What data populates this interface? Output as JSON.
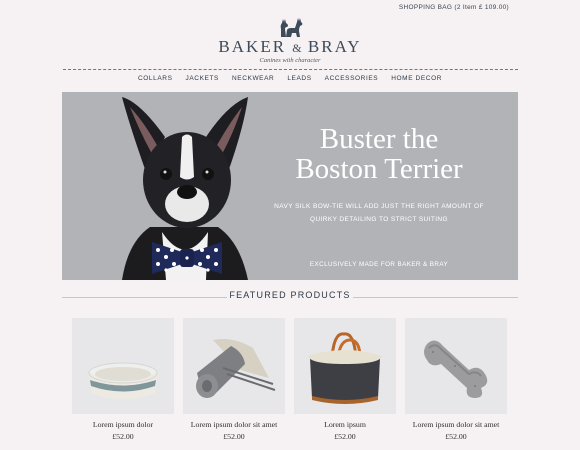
{
  "header": {
    "shopping_bag": "SHOPPING BAG (2 Item £ 109.00)",
    "brand_left": "BAKER",
    "brand_amp": "&",
    "brand_right": "BRAY",
    "tagline": "Canines with character"
  },
  "nav": {
    "items": [
      "COLLARS",
      "JACKETS",
      "NECKWEAR",
      "LEADS",
      "ACCESSORIES",
      "HOME DECOR"
    ]
  },
  "hero": {
    "title_line1": "Buster the",
    "title_line2": "Boston Terrier",
    "desc_line1": "NAVY SILK BOW-TIE WILL ADD JUST THE RIGHT AMOUNT OF",
    "desc_line2": "QUIRKY DETAILING TO STRICT SUITING",
    "exclusive": "EXCLUSIVELY MADE FOR BAKER & BRAY"
  },
  "featured": {
    "title": "FEATURED PRODUCTS",
    "products": [
      {
        "name": "Lorem ipsum dolor",
        "price": "£52.00",
        "icon": "dog-bowl-icon"
      },
      {
        "name": "Lorem ipsum dolor sit amet",
        "price": "£52.00",
        "icon": "rolled-blanket-icon"
      },
      {
        "name": "Lorem ipsum",
        "price": "£52.00",
        "icon": "dog-carrier-bag-icon"
      },
      {
        "name": "Lorem ipsum dolor sit amet",
        "price": "£52.00",
        "icon": "bone-toy-icon"
      }
    ]
  },
  "colors": {
    "background": "#f6f2f3",
    "hero_bg": "#b2b3b7",
    "text_dark": "#3a4450"
  }
}
